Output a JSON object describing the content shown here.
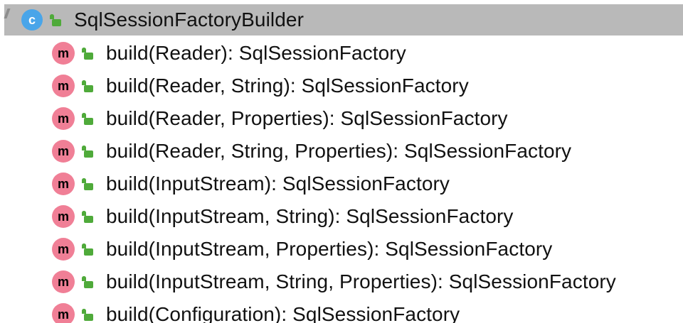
{
  "class_node": {
    "badge": "c",
    "icon": "public-lock-icon",
    "name": "SqlSessionFactoryBuilder"
  },
  "methods": [
    {
      "badge": "m",
      "icon": "public-lock-icon",
      "label": "build(Reader): SqlSessionFactory"
    },
    {
      "badge": "m",
      "icon": "public-lock-icon",
      "label": "build(Reader, String): SqlSessionFactory"
    },
    {
      "badge": "m",
      "icon": "public-lock-icon",
      "label": "build(Reader, Properties): SqlSessionFactory"
    },
    {
      "badge": "m",
      "icon": "public-lock-icon",
      "label": "build(Reader, String, Properties): SqlSessionFactory"
    },
    {
      "badge": "m",
      "icon": "public-lock-icon",
      "label": "build(InputStream): SqlSessionFactory"
    },
    {
      "badge": "m",
      "icon": "public-lock-icon",
      "label": "build(InputStream, String): SqlSessionFactory"
    },
    {
      "badge": "m",
      "icon": "public-lock-icon",
      "label": "build(InputStream, Properties): SqlSessionFactory"
    },
    {
      "badge": "m",
      "icon": "public-lock-icon",
      "label": "build(InputStream, String, Properties): SqlSessionFactory"
    },
    {
      "badge": "m",
      "icon": "public-lock-icon",
      "label": "build(Configuration): SqlSessionFactory"
    }
  ],
  "colors": {
    "class_badge": "#49a5e9",
    "method_badge": "#f07f96",
    "public_icon": "#4faa3a",
    "selected_row": "#b9b9b9"
  }
}
